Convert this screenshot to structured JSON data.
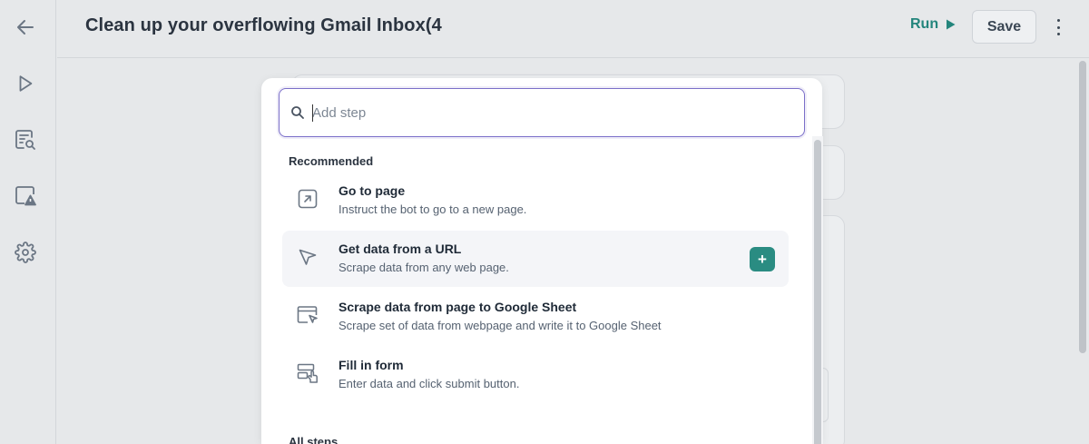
{
  "app": {
    "title": "Clean up your overflowing Gmail Inbox(4"
  },
  "sidebar": {
    "items": [
      {
        "icon": "arrow-left-icon",
        "name": "back"
      },
      {
        "icon": "play-icon",
        "name": "run"
      },
      {
        "icon": "document-search-icon",
        "name": "logs"
      },
      {
        "icon": "alert-monitor-icon",
        "name": "alerts"
      },
      {
        "icon": "gear-icon",
        "name": "settings"
      }
    ]
  },
  "toolbar": {
    "run_label": "Run",
    "save_label": "Save"
  },
  "add_step": {
    "placeholder": "Add step",
    "value": "",
    "recommended_label": "Recommended",
    "all_steps_label": "All steps",
    "items": [
      {
        "title": "Go to page",
        "description": "Instruct the bot to go to a new page.",
        "icon": "external-arrow-icon"
      },
      {
        "title": "Get data from a URL",
        "description": "Scrape data from any web page.",
        "icon": "cursor-pointer-icon",
        "hovered": true,
        "action": "+"
      },
      {
        "title": "Scrape data from page to Google Sheet",
        "description": "Scrape set of data from webpage and write it to Google Sheet",
        "icon": "screen-cursor-icon"
      },
      {
        "title": "Fill in form",
        "description": "Enter data and click submit button.",
        "icon": "form-hand-icon"
      }
    ]
  },
  "colors": {
    "accent": "#2a8c82",
    "run": "#23857c",
    "focus": "#7b6fc9"
  }
}
